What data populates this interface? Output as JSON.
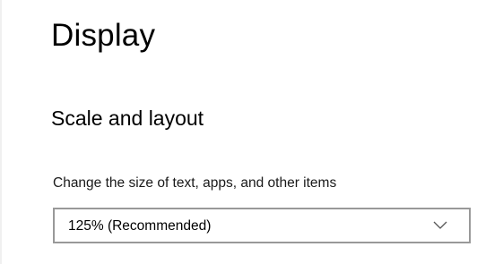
{
  "page": {
    "title": "Display"
  },
  "scale_layout": {
    "section_title": "Scale and layout",
    "size_setting": {
      "label": "Change the size of text, apps, and other items",
      "selected_value": "125% (Recommended)",
      "icon": "chevron-down-icon"
    }
  },
  "colors": {
    "dropdown_border": "#999999",
    "background": "#ffffff"
  }
}
